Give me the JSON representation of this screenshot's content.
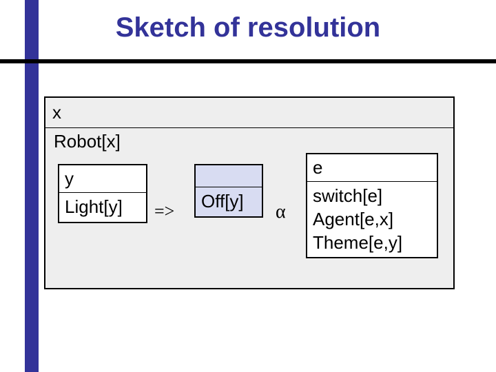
{
  "title": "Sketch of resolution",
  "outer": {
    "head": "x",
    "predicate": "Robot[x]"
  },
  "yBox": {
    "head": "y",
    "body": "Light[y]"
  },
  "offBox": {
    "head": "",
    "body": "Off[y]"
  },
  "arrow": "=>",
  "alpha": "α",
  "eBox": {
    "head": "e",
    "line1": "switch[e]",
    "line2": "Agent[e,x]",
    "line3": "Theme[e,y]"
  }
}
